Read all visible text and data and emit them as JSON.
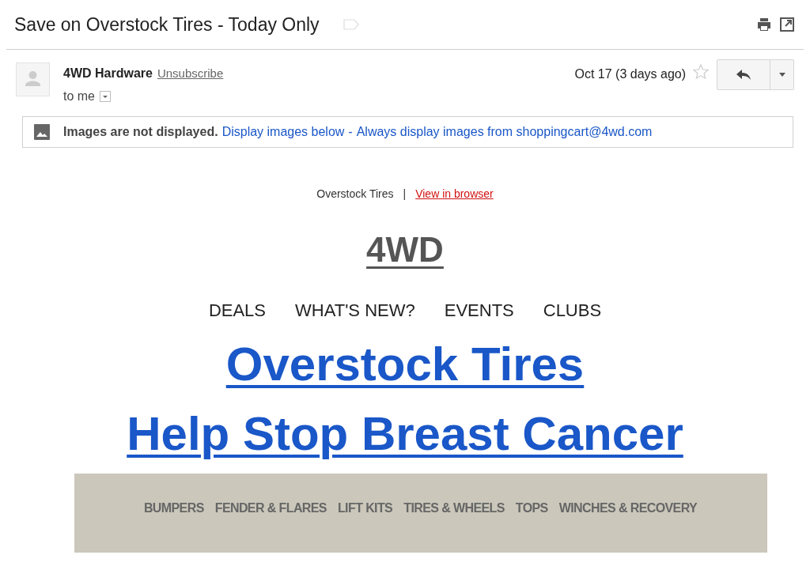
{
  "subject": "Save on Overstock Tires - Today Only",
  "message": {
    "sender": "4WD Hardware",
    "unsubscribe": "Unsubscribe",
    "recipient": "to me",
    "date": "Oct 17 (3 days ago)",
    "starred": false
  },
  "images_notice": {
    "bold": "Images are not displayed.",
    "display_link": "Display images below",
    "separator": "-",
    "always_link": "Always display images from shoppingcart@4wd.com"
  },
  "email_body": {
    "preheader": "Overstock Tires",
    "divider": "|",
    "browser_link": "View in browser",
    "logo": "4WD",
    "nav": [
      "DEALS",
      "WHAT'S NEW?",
      "EVENTS",
      "CLUBS"
    ],
    "headlines": [
      "Overstock Tires",
      "Help Stop Breast Cancer"
    ],
    "categories": [
      "BUMPERS",
      "FENDER & FLARES",
      "LIFT KITS",
      "TIRES & WHEELS",
      "TOPS",
      "WINCHES & RECOVERY"
    ]
  }
}
